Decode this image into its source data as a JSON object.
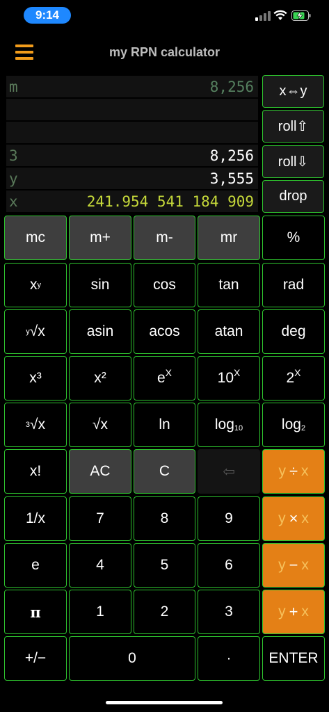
{
  "status": {
    "time": "9:14"
  },
  "header": {
    "title": "my RPN calculator"
  },
  "stack": [
    {
      "label": "m",
      "value": "8,256",
      "kind": "mem"
    },
    {
      "label": "",
      "value": "",
      "kind": "empty"
    },
    {
      "label": "",
      "value": "",
      "kind": "empty"
    },
    {
      "label": "3",
      "value": "8,256",
      "kind": "reg"
    },
    {
      "label": "y",
      "value": "3,555",
      "kind": "reg"
    },
    {
      "label": "x",
      "value": "241.954 541 184 909",
      "kind": "x"
    }
  ],
  "side_buttons": {
    "swap": "x⇔y",
    "roll_up": "roll⇧",
    "roll_down": "roll⇩",
    "drop": "drop"
  },
  "keys": {
    "mc": "mc",
    "mplus": "m+",
    "mminus": "m-",
    "mr": "mr",
    "percent": "%",
    "xy_base": "x",
    "xy_exp": "y",
    "sin": "sin",
    "cos": "cos",
    "tan": "tan",
    "rad": "rad",
    "yroot_idx": "y",
    "yroot_sym": "√x",
    "asin": "asin",
    "acos": "acos",
    "atan": "atan",
    "deg": "deg",
    "cube": "x³",
    "square": "x²",
    "exp_base": "e",
    "exp_exp": "X",
    "ten_base": "10",
    "ten_exp": "X",
    "two_base": "2",
    "two_exp": "X",
    "cbrt_idx": "3",
    "cbrt_sym": "√x",
    "sqrt": "√x",
    "ln": "ln",
    "log10_base": "log",
    "log10_sub": "10",
    "log2_base": "log",
    "log2_sub": "2",
    "fact": "x!",
    "ac": "AC",
    "c": "C",
    "backspace": "⇦",
    "div_y": "y",
    "div_op": "÷",
    "div_x": "x",
    "inv": "1/x",
    "d7": "7",
    "d8": "8",
    "d9": "9",
    "mul_y": "y",
    "mul_op": "×",
    "mul_x": "x",
    "e": "e",
    "d4": "4",
    "d5": "5",
    "d6": "6",
    "sub_y": "y",
    "sub_op": "−",
    "sub_x": "x",
    "pi": "π",
    "d1": "1",
    "d2": "2",
    "d3": "3",
    "add_y": "y",
    "add_op": "+",
    "add_x": "x",
    "sign": "+/−",
    "d0": "0",
    "dot": "·",
    "enter": "ENTER"
  },
  "colors": {
    "accent_orange": "#e48016",
    "border_green": "#2ec42e",
    "x_value": "#c6d93a",
    "menu": "#f29c1b"
  }
}
